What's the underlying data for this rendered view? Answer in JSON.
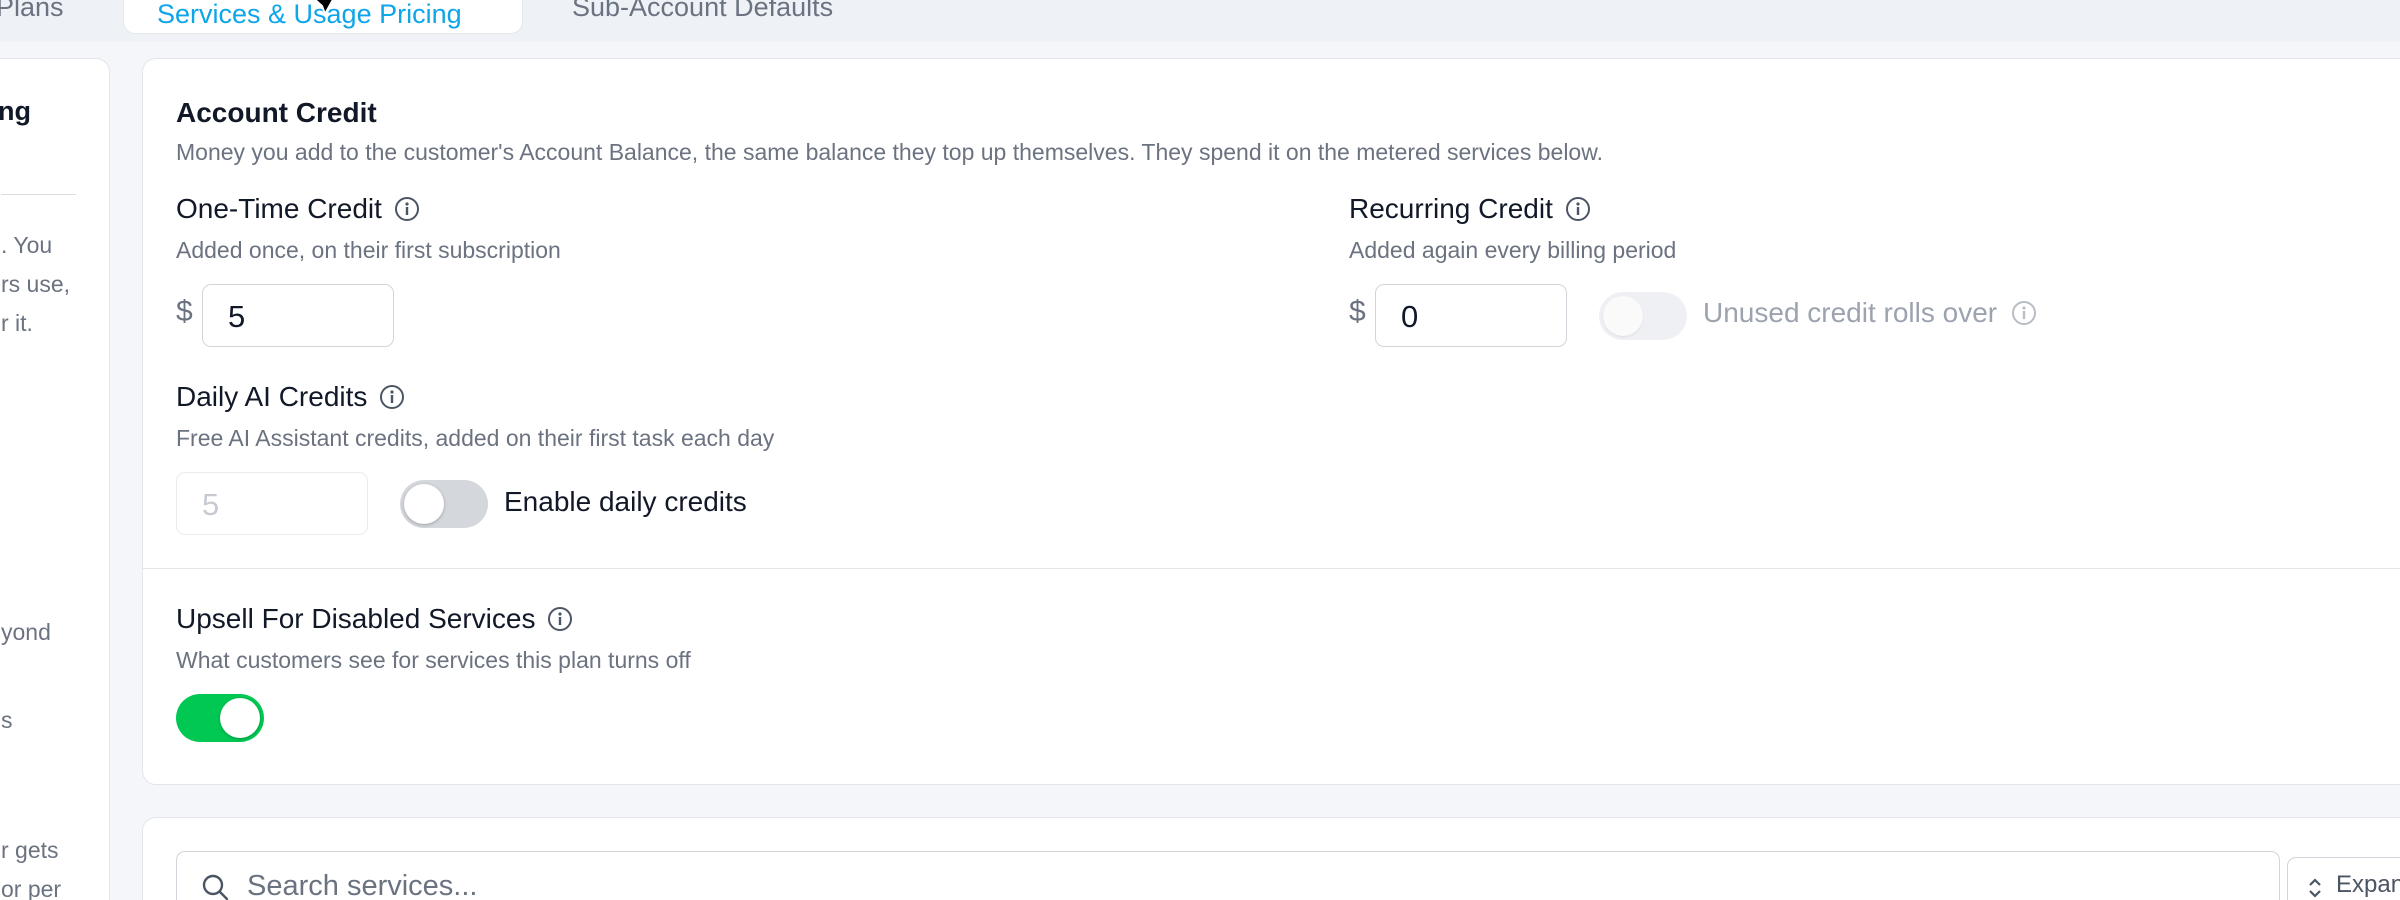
{
  "tabs": [
    {
      "label": "Plans"
    },
    {
      "label": "Services & Usage Pricing",
      "active": true
    },
    {
      "label": "Sub-Account Defaults"
    }
  ],
  "left_panel": {
    "title_fragment": "ng",
    "lines": [
      ". You",
      "rs use,",
      "r it.",
      "yond",
      "s",
      "r gets",
      "or per"
    ]
  },
  "account_credit": {
    "title": "Account Credit",
    "description": "Money you add to the customer's Account Balance, the same balance they top up themselves. They spend it on the metered services below."
  },
  "one_time_credit": {
    "label": "One-Time Credit",
    "description": "Added once, on their first subscription",
    "currency": "$",
    "value": "5"
  },
  "recurring_credit": {
    "label": "Recurring Credit",
    "description": "Added again every billing period",
    "currency": "$",
    "value": "0",
    "rollover_label": "Unused credit rolls over",
    "rollover_enabled": false
  },
  "daily_ai_credits": {
    "label": "Daily AI Credits",
    "description": "Free AI Assistant credits, added on their first task each day",
    "value": "5",
    "toggle_label": "Enable daily credits",
    "enabled": false
  },
  "upsell": {
    "label": "Upsell For Disabled Services",
    "description": "What customers see for services this plan turns off",
    "enabled": true
  },
  "search": {
    "placeholder": "Search services..."
  },
  "expand_button": {
    "label": "Expan"
  },
  "colors": {
    "accent": "#0ea5e9",
    "toggle_on": "#00c853",
    "toggle_off": "#d4d7dc"
  },
  "icons": [
    "info-icon",
    "search-icon",
    "chevron-up-down-icon",
    "cursor-icon"
  ]
}
